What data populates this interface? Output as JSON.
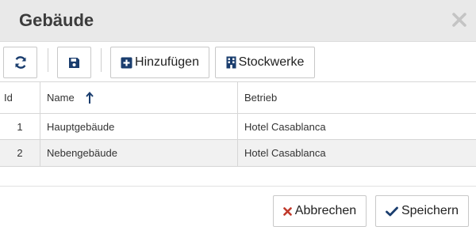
{
  "dialog": {
    "title": "Gebäude",
    "close_icon": "close-icon"
  },
  "toolbar": {
    "refresh_icon": "refresh-icon",
    "save_icon": "floppy-disk-icon",
    "add_label": "Hinzufügen",
    "add_icon": "plus-square-icon",
    "floors_label": "Stockwerke",
    "floors_icon": "building-icon"
  },
  "grid": {
    "columns": [
      "Id",
      "Name",
      "Betrieb"
    ],
    "sort_column": "Name",
    "sort_direction": "ascending",
    "rows": [
      {
        "id": "1",
        "name": "Hauptgebäude",
        "betrieb": "Hotel Casablanca"
      },
      {
        "id": "2",
        "name": "Nebengebäude",
        "betrieb": "Hotel Casablanca"
      }
    ]
  },
  "footer": {
    "cancel_label": "Abbrechen",
    "cancel_icon": "x-icon",
    "save_label": "Speichern",
    "save_icon": "check-icon"
  },
  "colors": {
    "titlebar": "#e9e9e9",
    "accent_blue": "#1a3d6e",
    "cancel_red": "#c0392b",
    "alt_row": "#f1f1f1"
  }
}
